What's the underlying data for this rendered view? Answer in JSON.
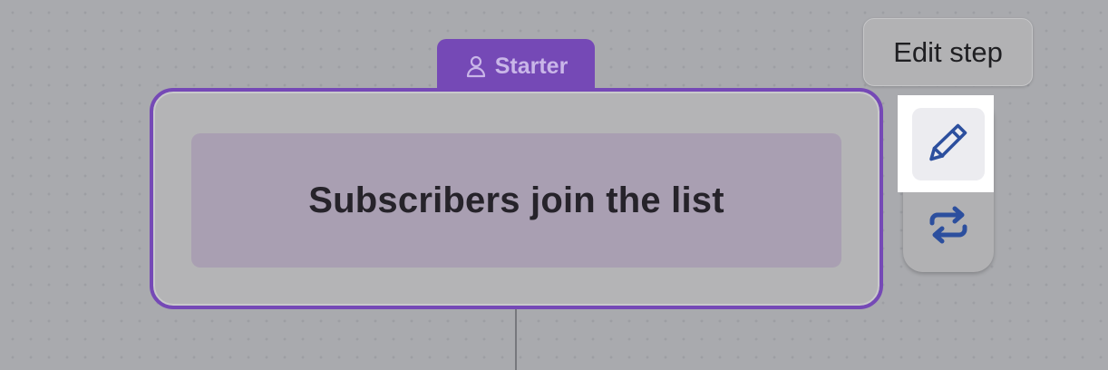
{
  "canvas": {
    "background_color": "#a9aaae",
    "dot_color": "#9d9ea3"
  },
  "step": {
    "badge_label": "Starter",
    "badge_icon": "user-icon",
    "title": "Subscribers join the list",
    "accent_color": "#7549b6"
  },
  "tooltip": {
    "text": "Edit step"
  },
  "toolbar": {
    "edit_icon": "pencil-icon",
    "swap_icon": "swap-arrows-icon",
    "icon_color": "#2c4f9e"
  }
}
